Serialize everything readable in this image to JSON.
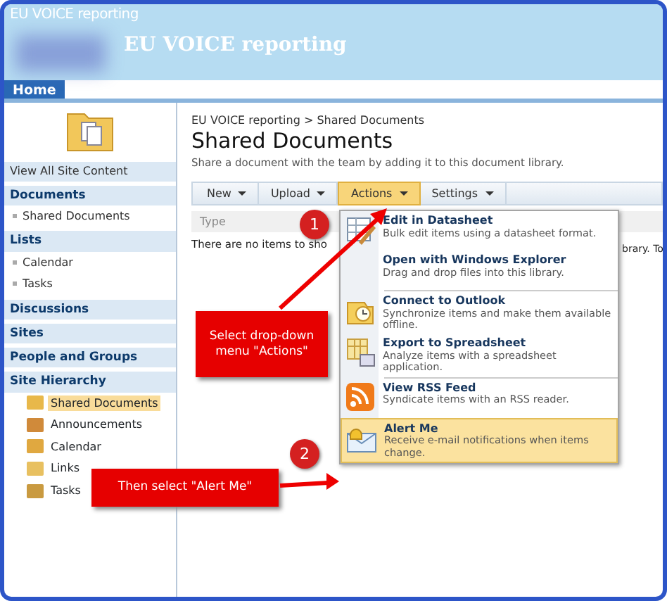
{
  "header": {
    "site_label": "EU VOICE reporting",
    "site_title": "EU VOICE reporting"
  },
  "top_nav": [
    {
      "label": "Home",
      "selected": true
    }
  ],
  "sidebar": {
    "view_all": "View All Site Content",
    "sections": [
      {
        "heading": "Documents",
        "items": [
          "Shared Documents"
        ]
      },
      {
        "heading": "Lists",
        "items": [
          "Calendar",
          "Tasks"
        ]
      },
      {
        "heading": "Discussions"
      },
      {
        "heading": "Sites"
      },
      {
        "heading": "People and Groups"
      },
      {
        "heading": "Site Hierarchy"
      }
    ],
    "tree": [
      {
        "label": "Shared Documents",
        "kind": "library",
        "selected": true
      },
      {
        "label": "Announcements",
        "kind": "announcements",
        "selected": false
      },
      {
        "label": "Calendar",
        "kind": "calendar",
        "selected": false
      },
      {
        "label": "Links",
        "kind": "links",
        "selected": false
      },
      {
        "label": "Tasks",
        "kind": "tasks",
        "selected": false
      }
    ]
  },
  "breadcrumb": "EU VOICE reporting > Shared Documents",
  "page_title": "Shared Documents",
  "description": "Share a document with the team by adding it to this document library.",
  "toolbar": [
    {
      "label": "New",
      "selected": false
    },
    {
      "label": "Upload",
      "selected": false
    },
    {
      "label": "Actions",
      "selected": true
    },
    {
      "label": "Settings",
      "selected": false
    }
  ],
  "table": {
    "columns": [
      "Type"
    ],
    "empty_message": "There are no items to sho",
    "empty_message_tail": "brary. To"
  },
  "actions_menu": [
    {
      "kind": "datasheet",
      "title": "Edit in Datasheet",
      "description": "Bulk edit items using a datasheet format.",
      "selected": false,
      "divider_above": false
    },
    {
      "kind": "explorer",
      "title": "Open with Windows Explorer",
      "description": "Drag and drop files into this library.",
      "selected": false,
      "divider_above": false
    },
    {
      "kind": "outlook",
      "title": "Connect to Outlook",
      "description": "Synchronize items and make them available offline.",
      "selected": false,
      "divider_above": true
    },
    {
      "kind": "spreadsheet",
      "title": "Export to Spreadsheet",
      "description": "Analyze items with a spreadsheet application.",
      "selected": false,
      "divider_above": false
    },
    {
      "kind": "rss",
      "title": "View RSS Feed",
      "description": "Syndicate items with an RSS reader.",
      "selected": false,
      "divider_above": true
    },
    {
      "kind": "alert",
      "title": "Alert Me",
      "description": "Receive e-mail notifications when items change.",
      "selected": true,
      "divider_above": false
    }
  ],
  "annotations": [
    {
      "number": "1",
      "text": "Select drop-down menu \"Actions\""
    },
    {
      "number": "2",
      "text": "Then select \"Alert Me\""
    }
  ]
}
